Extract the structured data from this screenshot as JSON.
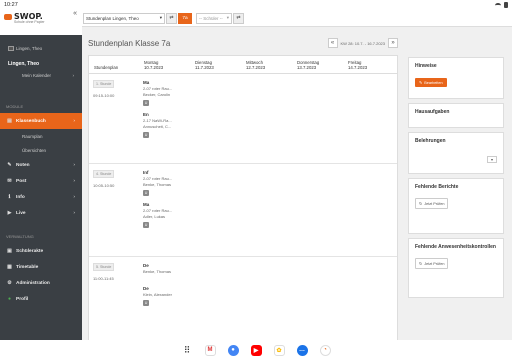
{
  "status": {
    "time": "10:27"
  },
  "app": {
    "name": "SWOP.",
    "tagline": "Schule ohne Papier"
  },
  "user": {
    "avatar_alt": "Lingen, Theo",
    "name": "Lingen, Theo",
    "calendar": "Mein Kalender"
  },
  "sidebar": {
    "section_modules": "MODULE",
    "active": "Klassenbuch",
    "subitems": [
      "Raumplan",
      "Übersichten"
    ],
    "items": [
      {
        "label": "Noten",
        "icon": "notes-icon"
      },
      {
        "label": "Post",
        "icon": "chat-icon"
      },
      {
        "label": "Info",
        "icon": "info-icon"
      },
      {
        "label": "Live",
        "icon": "video-icon"
      }
    ],
    "section_admin": "VERWALTUNG",
    "admin_items": [
      "Schülerakte",
      "Timetable",
      "Administration",
      "Profil"
    ]
  },
  "topbar": {
    "plan_select": "Stundenplan Lingen, Theo",
    "class_button": "7a",
    "student_select": "-- Schüler --"
  },
  "main": {
    "title": "Stundenplan Klasse 7a",
    "week_label": "KW 28: 10.7. - 16.7.2023",
    "column_first": "Stundenplan",
    "days": [
      {
        "name": "Montag",
        "date": "10.7.2023"
      },
      {
        "name": "Dienstag",
        "date": "11.7.2023"
      },
      {
        "name": "Mittwoch",
        "date": "12.7.2023"
      },
      {
        "name": "Donnerstag",
        "date": "13.7.2023"
      },
      {
        "name": "Freitag",
        "date": "14.7.2023"
      }
    ],
    "rows": [
      {
        "badge": "1. Stunde",
        "time": "09:15-10:00",
        "lessons": [
          {
            "subject": "Ma",
            "room": "2-07 roter Rau...",
            "teacher": "Becker, Carolin",
            "chip": "U"
          },
          {
            "subject": "En",
            "room": "2-17 NaWi-Ra...",
            "teacher": "Annuscheit, C...",
            "chip": "U"
          }
        ]
      },
      {
        "badge": "4. Stunde",
        "time": "10:05-10:50",
        "lessons": [
          {
            "subject": "Inf",
            "room": "2-07 roter Rau...",
            "teacher": "Benke, Thomas",
            "chip": "U"
          },
          {
            "subject": "Ma",
            "room": "2-07 roter Rau...",
            "teacher": "Adler, Lukas",
            "chip": "U"
          }
        ]
      },
      {
        "badge": "5. Stunde",
        "time": "11:00-11:45",
        "lessons": [
          {
            "subject": "De",
            "room": "",
            "teacher": "Benke, Thomas",
            "chip": ""
          },
          {
            "subject": "De",
            "room": "",
            "teacher": "Klein, Alexander",
            "chip": "U"
          }
        ]
      }
    ]
  },
  "right": {
    "hinweise": "Hinweise",
    "edit_button": "Bearbeiten",
    "hausaufgaben": "Hausaufgaben",
    "belehrungen": "Belehrungen",
    "fehlende_berichte": "Fehlende Berichte",
    "check_now": "Jetzt Prüfen",
    "fehlende_anwesenheit": "Fehlende Anwesenheitskontrollen",
    "check_now_2": "Jetzt Prüfen"
  },
  "colors": {
    "accent": "#e8651a",
    "sidebar": "#3a3f44"
  }
}
